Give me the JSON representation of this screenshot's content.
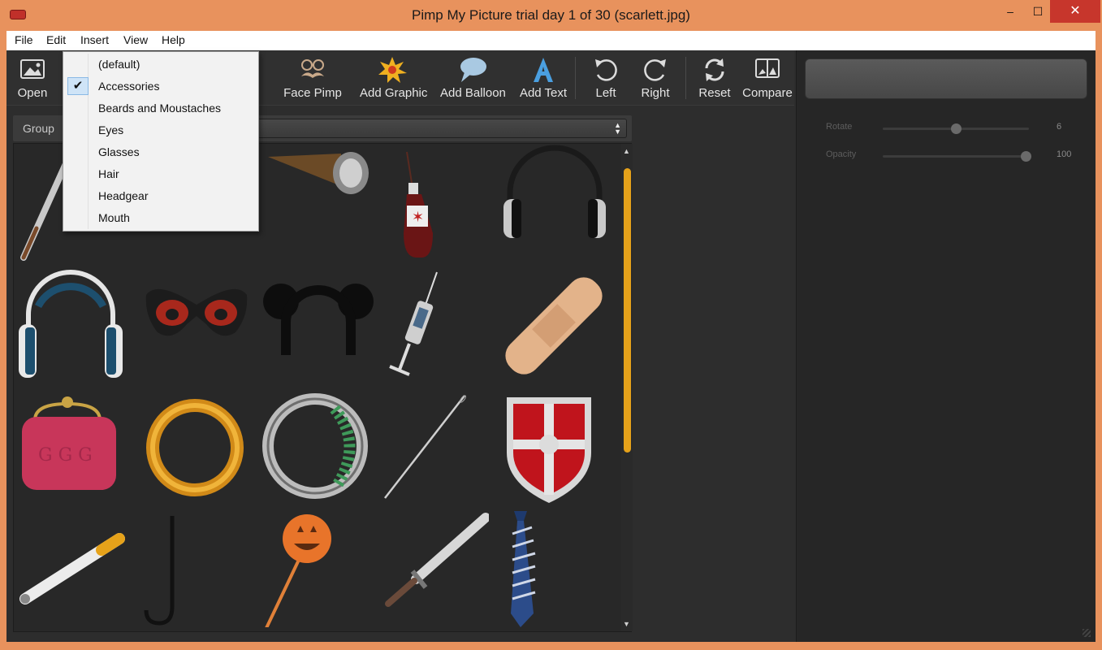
{
  "window": {
    "title": "Pimp My Picture trial day 1 of 30 (scarlett.jpg)",
    "minimize": "‒",
    "maximize": "☐",
    "close": "✕"
  },
  "menubar": {
    "items": [
      "File",
      "Edit",
      "Insert",
      "View",
      "Help"
    ]
  },
  "toolbar": {
    "open": "Open",
    "face_pimp": "Face Pimp",
    "add_graphic": "Add Graphic",
    "add_balloon": "Add Balloon",
    "add_text": "Add Text",
    "left": "Left",
    "right": "Right",
    "reset": "Reset",
    "compare": "Compare"
  },
  "group": {
    "label": "Group",
    "selected": ""
  },
  "dropdown": {
    "items": [
      {
        "label": "(default)",
        "checked": false
      },
      {
        "label": "Accessories",
        "checked": true
      },
      {
        "label": "Beards and Moustaches",
        "checked": false
      },
      {
        "label": "Eyes",
        "checked": false
      },
      {
        "label": "Glasses",
        "checked": false
      },
      {
        "label": "Hair",
        "checked": false
      },
      {
        "label": "Headgear",
        "checked": false
      },
      {
        "label": "Mouth",
        "checked": false
      }
    ]
  },
  "gallery": {
    "items": [
      "baseball-bat",
      "cigar",
      "blood-bottle",
      "black-headphones",
      "blue-headphones",
      "red-mask",
      "mouse-ears",
      "syringe",
      "bandage",
      "red-purse",
      "gold-ring",
      "diamond-ring",
      "needle",
      "shield",
      "cigarette",
      "cane",
      "pumpkin-lollipop",
      "knife",
      "striped-tie"
    ],
    "scroll_position": 0.0
  },
  "properties": {
    "rotate": {
      "label": "Rotate",
      "value": "6",
      "fraction": 0.5
    },
    "opacity": {
      "label": "Opacity",
      "value": "100",
      "fraction": 1.0
    }
  },
  "colors": {
    "accent": "#e6a21a",
    "titlebar": "#e8925d",
    "panel": "#2d2d2d"
  }
}
